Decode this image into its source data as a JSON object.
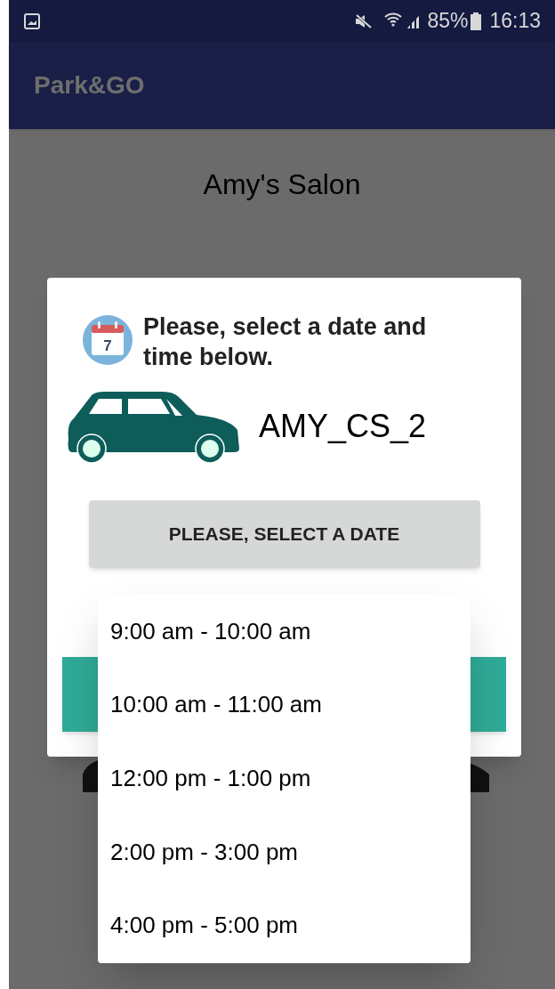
{
  "status_bar": {
    "battery": "85%",
    "time": "16:13"
  },
  "app_bar": {
    "title": "Park&GO"
  },
  "page": {
    "title": "Amy's Salon"
  },
  "dialog": {
    "calendar_day": "7",
    "message": "Please, select a date and time below.",
    "car_name": "AMY_CS_2",
    "date_button": "PLEASE, SELECT A DATE"
  },
  "time_options": [
    {
      "label": "9:00 am - 10:00 am"
    },
    {
      "label": "10:00 am - 11:00 am"
    },
    {
      "label": "12:00 pm - 1:00 pm"
    },
    {
      "label": "2:00 pm - 3:00 pm"
    },
    {
      "label": "4:00 pm - 5:00 pm"
    }
  ]
}
